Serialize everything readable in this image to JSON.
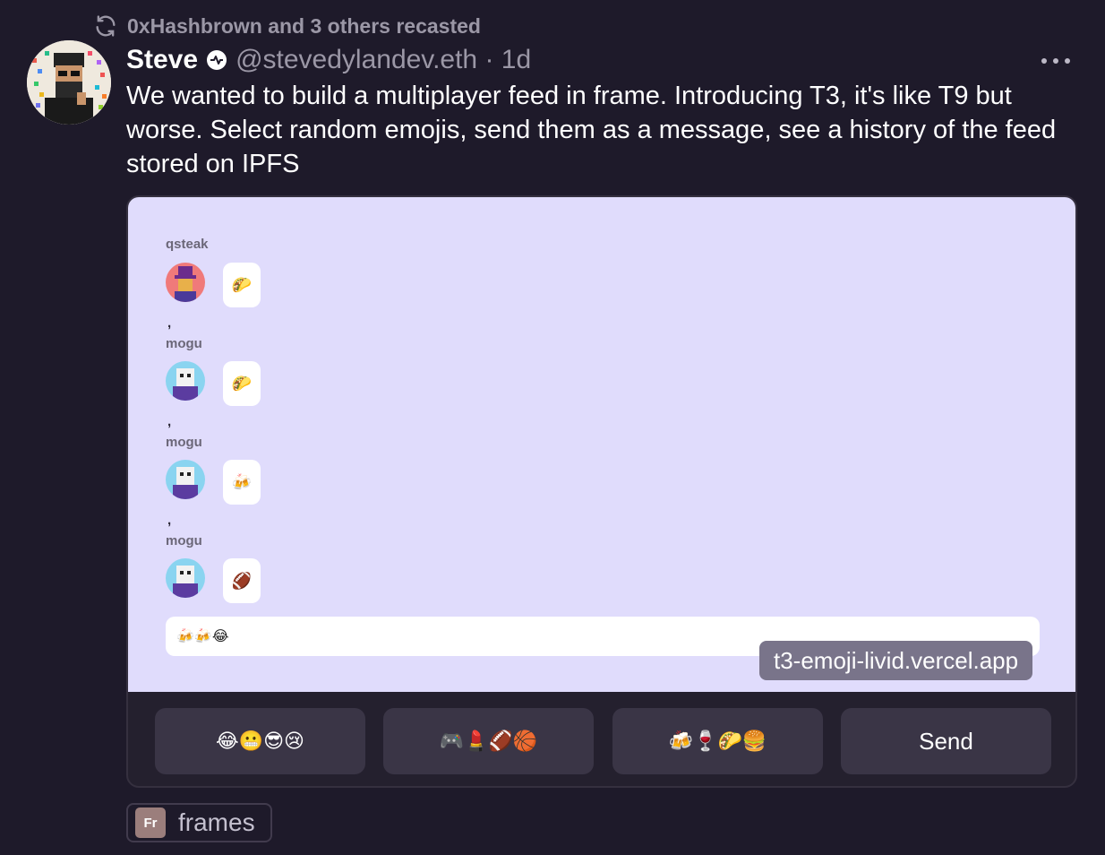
{
  "recast": {
    "text": "0xHashbrown and 3 others recasted",
    "icon": "recast-icon"
  },
  "cast": {
    "author_name": "Steve",
    "handle_line": "@stevedylandev.eth · 1d",
    "text": "We wanted to build a multiplayer feed in frame. Introducing T3, it's like T9 but worse. Select random emojis, send them as a message, see a history of the feed stored on IPFS"
  },
  "frame": {
    "messages": [
      {
        "user": "qsteak",
        "emoji": "🌮",
        "separator": ","
      },
      {
        "user": "mogu",
        "emoji": "🌮",
        "separator": ","
      },
      {
        "user": "mogu",
        "emoji": "🍻",
        "separator": ","
      },
      {
        "user": "mogu",
        "emoji": "🏈",
        "separator": ""
      }
    ],
    "input_value": "🍻🍻😂",
    "url": "t3-emoji-livid.vercel.app",
    "buttons": [
      {
        "label": "😂😬😎😢"
      },
      {
        "label": "🎮💄🏈🏀"
      },
      {
        "label": "🍻🍷🌮🍔"
      },
      {
        "label": "Send"
      }
    ]
  },
  "channel": {
    "icon_text": "Fr",
    "label": "frames"
  },
  "colors": {
    "background": "#1e1a2a",
    "frame_bg": "#e0dcfc",
    "button_bg": "#3a3546",
    "muted_text": "#9b97a6"
  }
}
